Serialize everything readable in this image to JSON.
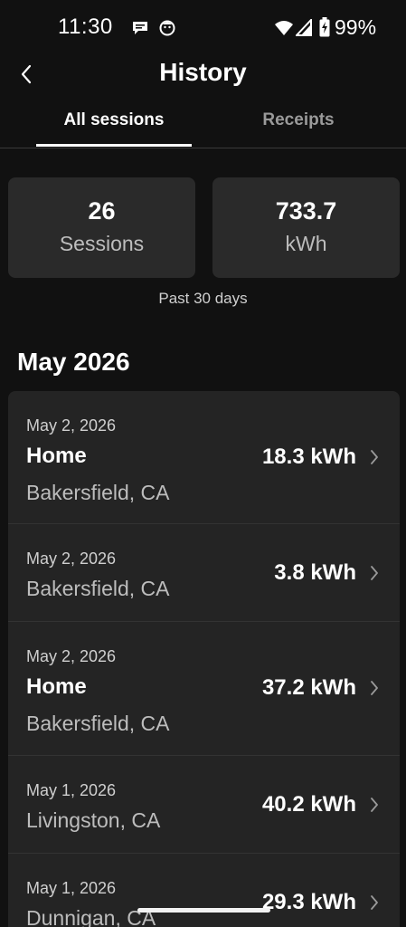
{
  "status_bar": {
    "time": "11:30",
    "battery_text": "99%",
    "icons": [
      "message-icon",
      "face-icon",
      "wifi-icon",
      "signal-icon",
      "battery-icon"
    ]
  },
  "header": {
    "title": "History",
    "back_icon": "chevron-left-icon"
  },
  "tabs": [
    {
      "label": "All sessions",
      "active": true
    },
    {
      "label": "Receipts",
      "active": false
    }
  ],
  "summary": {
    "sessions_value": "26",
    "sessions_label": "Sessions",
    "energy_value": "733.7",
    "energy_label": "kWh",
    "period": "Past 30 days"
  },
  "month": "May 2026",
  "sessions": [
    {
      "date": "May 2, 2026",
      "name": "Home",
      "location": "Bakersfield, CA",
      "energy": "18.3 kWh"
    },
    {
      "date": "May 2, 2026",
      "name": "",
      "location": "Bakersfield, CA",
      "energy": "3.8 kWh"
    },
    {
      "date": "May 2, 2026",
      "name": "Home",
      "location": "Bakersfield, CA",
      "energy": "37.2 kWh"
    },
    {
      "date": "May 1, 2026",
      "name": "",
      "location": "Livingston, CA",
      "energy": "40.2 kWh"
    },
    {
      "date": "May 1, 2026",
      "name": "",
      "location": "Dunnigan, CA",
      "energy": "29.3 kWh"
    }
  ],
  "colors": {
    "background": "#111111",
    "card": "#2a2a2a",
    "list": "#242424",
    "text": "#ffffff",
    "muted": "#bdbdbd",
    "inactive_tab": "#9a9a9a"
  }
}
